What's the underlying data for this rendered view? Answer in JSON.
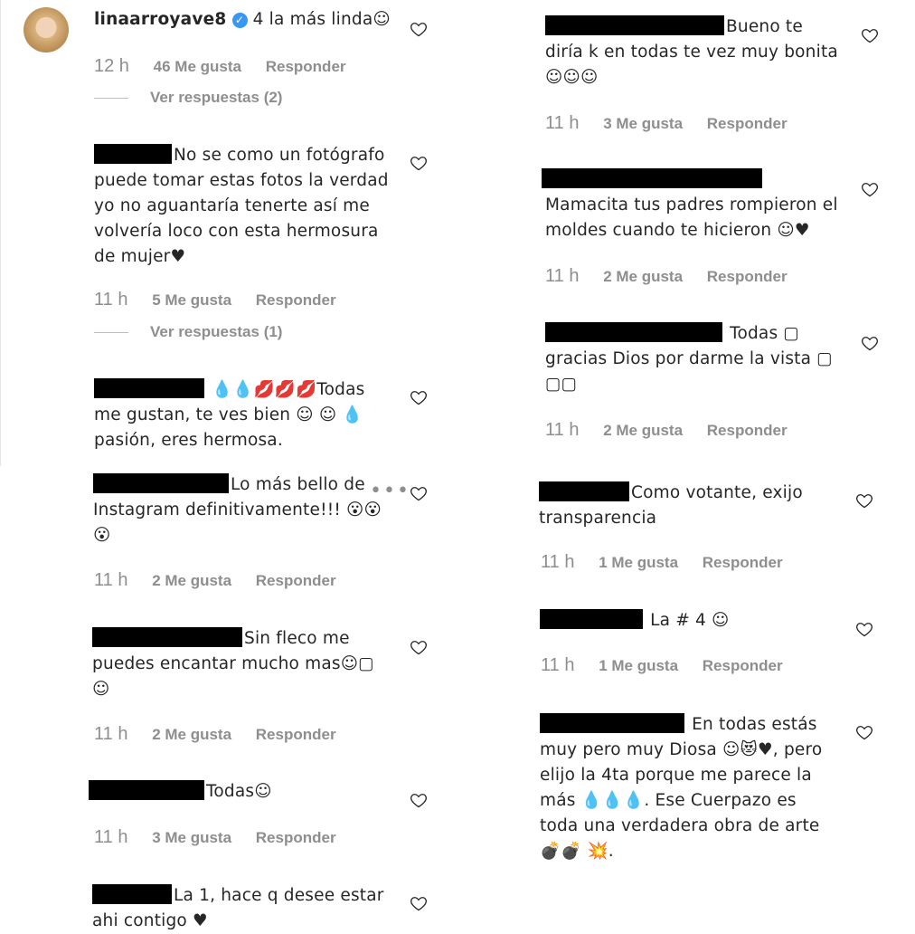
{
  "comments_left": [
    {
      "username": "linaarroyave8",
      "text": "4 la más linda☺",
      "time": "12 h",
      "likes": "46 Me gusta",
      "reply": "Responder",
      "view_replies": "Ver respuestas (2)"
    },
    {
      "text": "No se como un fotógrafo puede tomar estas fotos la verdad yo no aguantaría tenerte así me volvería loco con esta hermosura de mujer♥",
      "time": "11 h",
      "likes": "5 Me gusta",
      "reply": "Responder",
      "view_replies": "Ver respuestas (1)"
    },
    {
      "text": "💧💧💋💋💋Todas me gustan, te ves bien ☺ ☺ 💧 pasión, eres hermosa."
    },
    {
      "text": "Lo más bello de Instagram definitivamente!!! 😮😮 😮",
      "time": "11 h",
      "likes": "2 Me gusta",
      "reply": "Responder"
    },
    {
      "text": "Sin fleco me puedes encantar mucho mas☺▢ ☺",
      "time": "11 h",
      "likes": "2 Me gusta",
      "reply": "Responder"
    },
    {
      "text": "Todas☺",
      "time": "11 h",
      "likes": "3 Me gusta",
      "reply": "Responder"
    },
    {
      "text": "La 1, hace q desee estar ahi contigo ♥"
    }
  ],
  "comments_right": [
    {
      "text": "Bueno te diría k en todas te vez muy bonita ☺☺☺",
      "time": "11 h",
      "likes": "3 Me gusta",
      "reply": "Responder"
    },
    {
      "text": "Mamacita tus padres rompieron el moldes cuando te hicieron ☺♥",
      "time": "11 h",
      "likes": "2 Me gusta",
      "reply": "Responder"
    },
    {
      "text": "Todas ▢ gracias Dios por darme la vista ▢ ▢▢",
      "time": "11 h",
      "likes": "2 Me gusta",
      "reply": "Responder"
    },
    {
      "text": "Como votante, exijo transparencia",
      "time": "11 h",
      "likes": "1 Me gusta",
      "reply": "Responder"
    },
    {
      "text": "La # 4 ☺",
      "time": "11 h",
      "likes": "1 Me gusta",
      "reply": "Responder"
    },
    {
      "text": "En todas estás muy pero muy Diosa ☺😻♥, pero elijo la 4ta porque me parece la más 💧💧💧. Ese Cuerpazo es toda una verdadera obra de arte 💣💣 💥."
    }
  ],
  "more_options_icon": "more-horizontal-icon",
  "like_icon": "heart-outline-icon",
  "colors": {
    "text": "#262626",
    "meta": "#8e8e8e",
    "verified": "#3897f0"
  }
}
